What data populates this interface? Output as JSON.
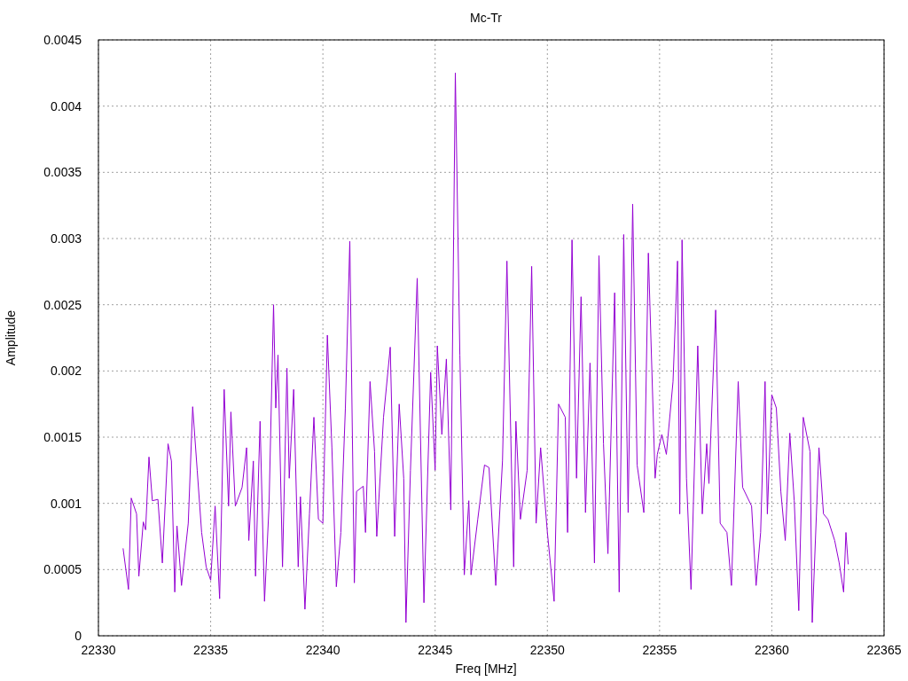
{
  "chart_data": {
    "type": "line",
    "grid": true,
    "title": "Mc-Tr",
    "xlabel": "Freq [MHz]",
    "ylabel": "Amplitude",
    "xlim": [
      22330,
      22365
    ],
    "ylim": [
      0,
      0.0045
    ],
    "xticks": [
      22330,
      22335,
      22340,
      22345,
      22350,
      22355,
      22360,
      22365
    ],
    "yticks": [
      0,
      0.0005,
      0.001,
      0.0015,
      0.002,
      0.0025,
      0.003,
      0.0035,
      0.004,
      0.0045
    ],
    "x": [
      22331.1,
      22331.34,
      22331.46,
      22331.7,
      22331.8,
      22332.0,
      22332.1,
      22332.25,
      22332.4,
      22332.65,
      22332.85,
      22333.1,
      22333.25,
      22333.4,
      22333.5,
      22333.7,
      22334.0,
      22334.2,
      22334.4,
      22334.6,
      22334.8,
      22335.0,
      22335.2,
      22335.4,
      22335.6,
      22335.8,
      22335.9,
      22336.1,
      22336.4,
      22336.6,
      22336.7,
      22336.9,
      22337.0,
      22337.2,
      22337.4,
      22337.6,
      22337.8,
      22337.9,
      22338.0,
      22338.2,
      22338.4,
      22338.5,
      22338.7,
      22338.9,
      22339.0,
      22339.2,
      22339.4,
      22339.6,
      22339.8,
      22340.0,
      22340.2,
      22340.4,
      22340.6,
      22340.8,
      22341.0,
      22341.2,
      22341.4,
      22341.5,
      22341.8,
      22341.9,
      22342.1,
      22342.3,
      22342.4,
      22342.7,
      22343.0,
      22343.2,
      22343.4,
      22343.6,
      22343.7,
      22343.9,
      22344.2,
      22344.5,
      22344.8,
      22345.0,
      22345.1,
      22345.3,
      22345.5,
      22345.7,
      22345.9,
      22346.1,
      22346.3,
      22346.5,
      22346.6,
      22346.9,
      22347.2,
      22347.4,
      22347.7,
      22348.0,
      22348.2,
      22348.5,
      22348.6,
      22348.8,
      22349.1,
      22349.3,
      22349.5,
      22349.7,
      22350.0,
      22350.3,
      22350.5,
      22350.8,
      22350.9,
      22351.1,
      22351.3,
      22351.5,
      22351.7,
      22351.9,
      22352.1,
      22352.3,
      22352.5,
      22352.7,
      22353.0,
      22353.2,
      22353.4,
      22353.6,
      22353.8,
      22354.0,
      22354.3,
      22354.5,
      22354.8,
      22354.9,
      22355.1,
      22355.3,
      22355.6,
      22355.8,
      22355.9,
      22356.0,
      22356.2,
      22356.4,
      22356.7,
      22356.9,
      22357.1,
      22357.2,
      22357.5,
      22357.7,
      22358.0,
      22358.2,
      22358.5,
      22358.7,
      22359.1,
      22359.3,
      22359.5,
      22359.7,
      22359.8,
      22360.0,
      22360.2,
      22360.4,
      22360.6,
      22360.8,
      22361.0,
      22361.2,
      22361.4,
      22361.7,
      22361.8,
      22362.1,
      22362.3,
      22362.5,
      22362.8,
      22363.0,
      22363.2,
      22363.3,
      22363.4
    ],
    "series": [
      {
        "color": "#9400d3",
        "values": [
          0.00066,
          0.00035,
          0.00104,
          0.00092,
          0.00045,
          0.00086,
          0.0008,
          0.00135,
          0.00102,
          0.00103,
          0.00055,
          0.00145,
          0.00132,
          0.00033,
          0.00083,
          0.00038,
          0.00085,
          0.00173,
          0.00125,
          0.00078,
          0.00052,
          0.00042,
          0.00098,
          0.00028,
          0.00186,
          0.00098,
          0.00169,
          0.00098,
          0.00112,
          0.00142,
          0.00072,
          0.00132,
          0.00045,
          0.00162,
          0.00026,
          0.00098,
          0.0025,
          0.00172,
          0.00212,
          0.00052,
          0.00202,
          0.00119,
          0.00186,
          0.00052,
          0.00105,
          0.0002,
          0.00092,
          0.00165,
          0.00088,
          0.00085,
          0.00227,
          0.00142,
          0.00037,
          0.00078,
          0.00172,
          0.00298,
          0.0004,
          0.00109,
          0.00113,
          0.00078,
          0.00192,
          0.00139,
          0.00075,
          0.00165,
          0.00218,
          0.00075,
          0.00175,
          0.00119,
          0.0001,
          0.00125,
          0.0027,
          0.00025,
          0.00199,
          0.00125,
          0.00219,
          0.00152,
          0.00209,
          0.00095,
          0.00425,
          0.00212,
          0.00046,
          0.00102,
          0.00046,
          0.00088,
          0.00129,
          0.00127,
          0.00038,
          0.00132,
          0.00283,
          0.00052,
          0.00162,
          0.00088,
          0.00125,
          0.00279,
          0.00085,
          0.00142,
          0.00078,
          0.00026,
          0.00175,
          0.00165,
          0.00078,
          0.00299,
          0.00119,
          0.00256,
          0.00093,
          0.00206,
          0.00055,
          0.00287,
          0.00145,
          0.00062,
          0.00259,
          0.00033,
          0.00303,
          0.00093,
          0.00326,
          0.00129,
          0.00093,
          0.00289,
          0.00119,
          0.00137,
          0.00152,
          0.00137,
          0.00192,
          0.00283,
          0.00092,
          0.00299,
          0.00119,
          0.00035,
          0.00219,
          0.00092,
          0.00145,
          0.00115,
          0.00246,
          0.00085,
          0.00078,
          0.00038,
          0.00192,
          0.00112,
          0.00098,
          0.00038,
          0.00078,
          0.00192,
          0.00092,
          0.00182,
          0.00172,
          0.00109,
          0.00072,
          0.00153,
          0.00102,
          0.00019,
          0.00165,
          0.00139,
          0.0001,
          0.00142,
          0.00092,
          0.00088,
          0.00072,
          0.00055,
          0.00033,
          0.00078,
          0.00054
        ]
      }
    ]
  }
}
